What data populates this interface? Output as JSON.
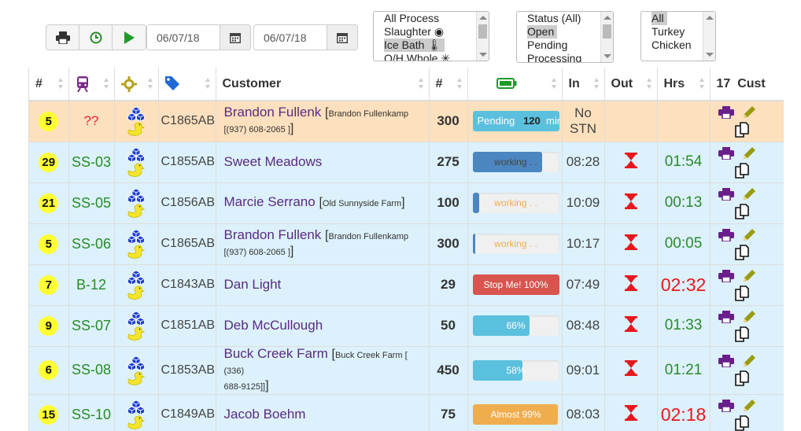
{
  "toolbar": {
    "print_icon": "printer-icon",
    "clock_icon": "clock-icon",
    "play_icon": "play-icon",
    "date_from": "06/07/18",
    "date_to": "06/07/18"
  },
  "process_list": [
    "All Process",
    "Slaughter ◉",
    "Ice Bath 🌡",
    "O/H Whole ✳"
  ],
  "process_selected": "Ice Bath 🌡",
  "status_list": [
    "Status (All)",
    "Open",
    "Pending",
    "Processing"
  ],
  "status_selected": "Open",
  "species_list": [
    "All",
    "Turkey",
    "Chicken"
  ],
  "species_selected": "All",
  "columns": [
    "#",
    "",
    "",
    "",
    "Customer",
    "#",
    "",
    "In",
    "Out",
    "Hrs",
    "17",
    "Cust"
  ],
  "colors": {
    "accent_green": "#2a8a2a",
    "red": "#e8171e",
    "purple": "#5a2a82",
    "info": "#5bc0de",
    "primary": "#337ab7",
    "danger": "#d9534f",
    "warning": "#f0ad4e"
  },
  "rows": [
    {
      "num": "5",
      "station": "??",
      "order": "C1865AB",
      "name": "Brandon Fullenk",
      "detail": "Brandon Fullenkamp",
      "detail2": "[(937) 608-2065 ]",
      "qty": "300",
      "bar_text": "Pending",
      "bar_extra": "120",
      "bar_unit": "min",
      "bar_pct": 100,
      "bar_color": "#5bc0de",
      "in": "No STN",
      "out": "",
      "hrs": "",
      "warn": true
    },
    {
      "num": "29",
      "station": "SS-03",
      "order": "C1855AB",
      "name": "Sweet Meadows",
      "detail": "",
      "detail2": "",
      "qty": "275",
      "bar_text": "working . .",
      "bar_pct": 80,
      "bar_color": "#4c86c0",
      "in": "08:28",
      "out": "hourglass",
      "hrs": "01:54",
      "hrs_red": false
    },
    {
      "num": "21",
      "station": "SS-05",
      "order": "C1856AB",
      "name": "Marcie Serrano",
      "detail": "Old Sunnyside Farm",
      "detail2": "",
      "qty": "100",
      "bar_text": "working . .",
      "bar_pct": 8,
      "bar_color": "#4c86c0",
      "in": "10:09",
      "out": "hourglass",
      "hrs": "00:13",
      "hrs_red": false
    },
    {
      "num": "5",
      "station": "SS-06",
      "order": "C1865AB",
      "name": "Brandon Fullenk",
      "detail": "Brandon Fullenkamp",
      "detail2": "[(937) 608-2065 ]",
      "qty": "300",
      "bar_text": "working . .",
      "bar_pct": 3,
      "bar_color": "#4c86c0",
      "in": "10:17",
      "out": "hourglass",
      "hrs": "00:05",
      "hrs_red": false
    },
    {
      "num": "7",
      "station": "B-12",
      "order": "C1843AB",
      "name": "Dan Light",
      "detail": "",
      "detail2": "",
      "qty": "29",
      "bar_text": "Stop Me! 100%",
      "bar_pct": 100,
      "bar_color": "#d9534f",
      "in": "07:49",
      "out": "hourglass",
      "hrs": "02:32",
      "hrs_red": true
    },
    {
      "num": "9",
      "station": "SS-07",
      "order": "C1851AB",
      "name": "Deb McCullough",
      "detail": "",
      "detail2": "",
      "qty": "50",
      "bar_text": "66%",
      "bar_pct": 66,
      "bar_color": "#5bc0de",
      "in": "08:48",
      "out": "hourglass",
      "hrs": "01:33",
      "hrs_red": false
    },
    {
      "num": "6",
      "station": "SS-08",
      "order": "C1853AB",
      "name": "Buck Creek Farm",
      "detail": "Buck Creek Farm [ (336)",
      "detail2": "688-9125]]",
      "qty": "450",
      "bar_text": "58%",
      "bar_pct": 58,
      "bar_color": "#5bc0de",
      "in": "09:01",
      "out": "hourglass",
      "hrs": "01:21",
      "hrs_red": false
    },
    {
      "num": "15",
      "station": "SS-10",
      "order": "C1849AB",
      "name": "Jacob Boehm",
      "detail": "",
      "detail2": "",
      "qty": "75",
      "bar_text": "Almost 99%",
      "bar_pct": 99,
      "bar_color": "#f0ad4e",
      "in": "08:03",
      "out": "hourglass",
      "hrs": "02:18",
      "hrs_red": true
    }
  ]
}
